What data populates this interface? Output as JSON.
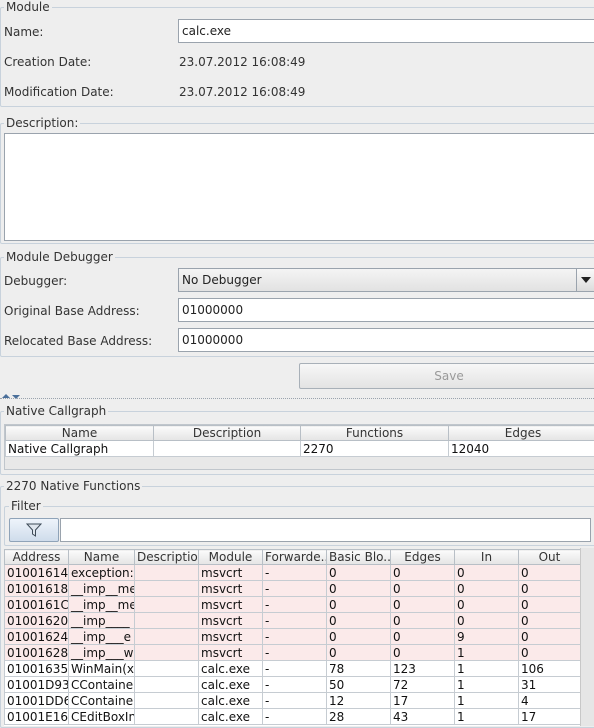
{
  "module": {
    "legend": "Module",
    "name_label": "Name:",
    "name_value": "calc.exe",
    "creation_label": "Creation Date:",
    "creation_value": "23.07.2012 16:08:49",
    "modification_label": "Modification Date:",
    "modification_value": "23.07.2012 16:08:49"
  },
  "description": {
    "legend": "Description:",
    "value": ""
  },
  "debugger": {
    "legend": "Module Debugger",
    "debugger_label": "Debugger:",
    "debugger_value": "No Debugger",
    "original_label": "Original Base Address:",
    "original_value": "01000000",
    "relocated_label": "Relocated Base Address:",
    "relocated_value": "01000000",
    "save_label": "Save"
  },
  "callgraph": {
    "legend": "Native Callgraph",
    "columns": [
      "Name",
      "Description",
      "Functions",
      "Edges"
    ],
    "rows": [
      [
        "Native Callgraph",
        "",
        "2270",
        "12040"
      ]
    ]
  },
  "functions": {
    "legend": "2270 Native Functions",
    "filter_legend": "Filter",
    "filter_value": "",
    "columns": [
      "Address",
      "Name",
      "Description",
      "Module",
      "Forwarde...",
      "Basic Blo...",
      "Edges",
      "In",
      "Out"
    ],
    "rows": [
      [
        "01001614",
        "exception::e",
        "",
        "msvcrt",
        "-",
        "0",
        "0",
        "0",
        "0"
      ],
      [
        "01001618",
        "__imp__me",
        "",
        "msvcrt",
        "-",
        "0",
        "0",
        "0",
        "0"
      ],
      [
        "0100161C",
        "__imp__me",
        "",
        "msvcrt",
        "-",
        "0",
        "0",
        "0",
        "0"
      ],
      [
        "01001620",
        "__imp____",
        "",
        "msvcrt",
        "-",
        "0",
        "0",
        "0",
        "0"
      ],
      [
        "01001624",
        "__imp___e",
        "",
        "msvcrt",
        "-",
        "0",
        "0",
        "9",
        "0"
      ],
      [
        "01001628",
        "__imp___w",
        "",
        "msvcrt",
        "-",
        "0",
        "0",
        "1",
        "0"
      ],
      [
        "01001635",
        "WinMain(x,x",
        "",
        "calc.exe",
        "-",
        "78",
        "123",
        "1",
        "106"
      ],
      [
        "01001D93",
        "CContainer",
        "",
        "calc.exe",
        "-",
        "50",
        "72",
        "1",
        "31"
      ],
      [
        "01001DD6",
        "CContainer",
        "",
        "calc.exe",
        "-",
        "12",
        "17",
        "1",
        "4"
      ],
      [
        "01001E16",
        "CEditBoxInp",
        "",
        "calc.exe",
        "-",
        "28",
        "43",
        "1",
        "17"
      ]
    ],
    "row_styles": [
      "pink",
      "pink",
      "pink",
      "pink",
      "pink",
      "pink",
      "white",
      "white",
      "white",
      "white"
    ]
  }
}
